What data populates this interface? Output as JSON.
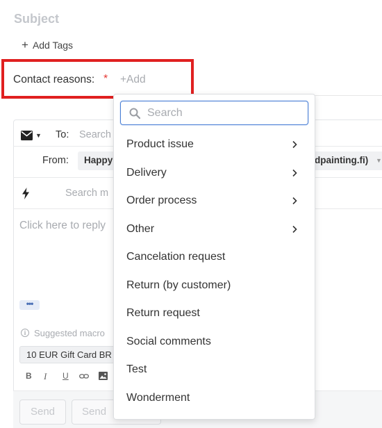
{
  "ticket": {
    "subject_placeholder": "Subject",
    "add_tags_label": "Add Tags",
    "contact_reasons_label": "Contact reasons:",
    "required_mark": "*",
    "add_reason_label": "+Add"
  },
  "composer": {
    "to_label": "To:",
    "to_placeholder": "Search",
    "from_label": "From:",
    "from_name": "Happy",
    "from_domain": "dpainting.fi)",
    "macro_search_placeholder": "Search m",
    "reply_placeholder": "Click here to reply",
    "more_label": "•••",
    "suggested_macros_label": "Suggested macro",
    "suggested_macro_chip": "10 EUR Gift Card BR",
    "format_bold": "B",
    "format_italic": "I",
    "format_underline": "U",
    "send_label": "Send",
    "send_secondary_label": "Send"
  },
  "dropdown": {
    "search_placeholder": "Search",
    "items": [
      {
        "label": "Product issue",
        "has_submenu": true
      },
      {
        "label": "Delivery",
        "has_submenu": true
      },
      {
        "label": "Order process",
        "has_submenu": true
      },
      {
        "label": "Other",
        "has_submenu": true
      },
      {
        "label": "Cancelation request",
        "has_submenu": false
      },
      {
        "label": "Return (by customer)",
        "has_submenu": false
      },
      {
        "label": "Return request",
        "has_submenu": false
      },
      {
        "label": "Social comments",
        "has_submenu": false
      },
      {
        "label": "Test",
        "has_submenu": false
      },
      {
        "label": "Wonderment",
        "has_submenu": false
      }
    ]
  },
  "colors": {
    "highlight_box": "#e02020",
    "required_star": "#e53935",
    "search_focus": "#4a7fd6"
  }
}
